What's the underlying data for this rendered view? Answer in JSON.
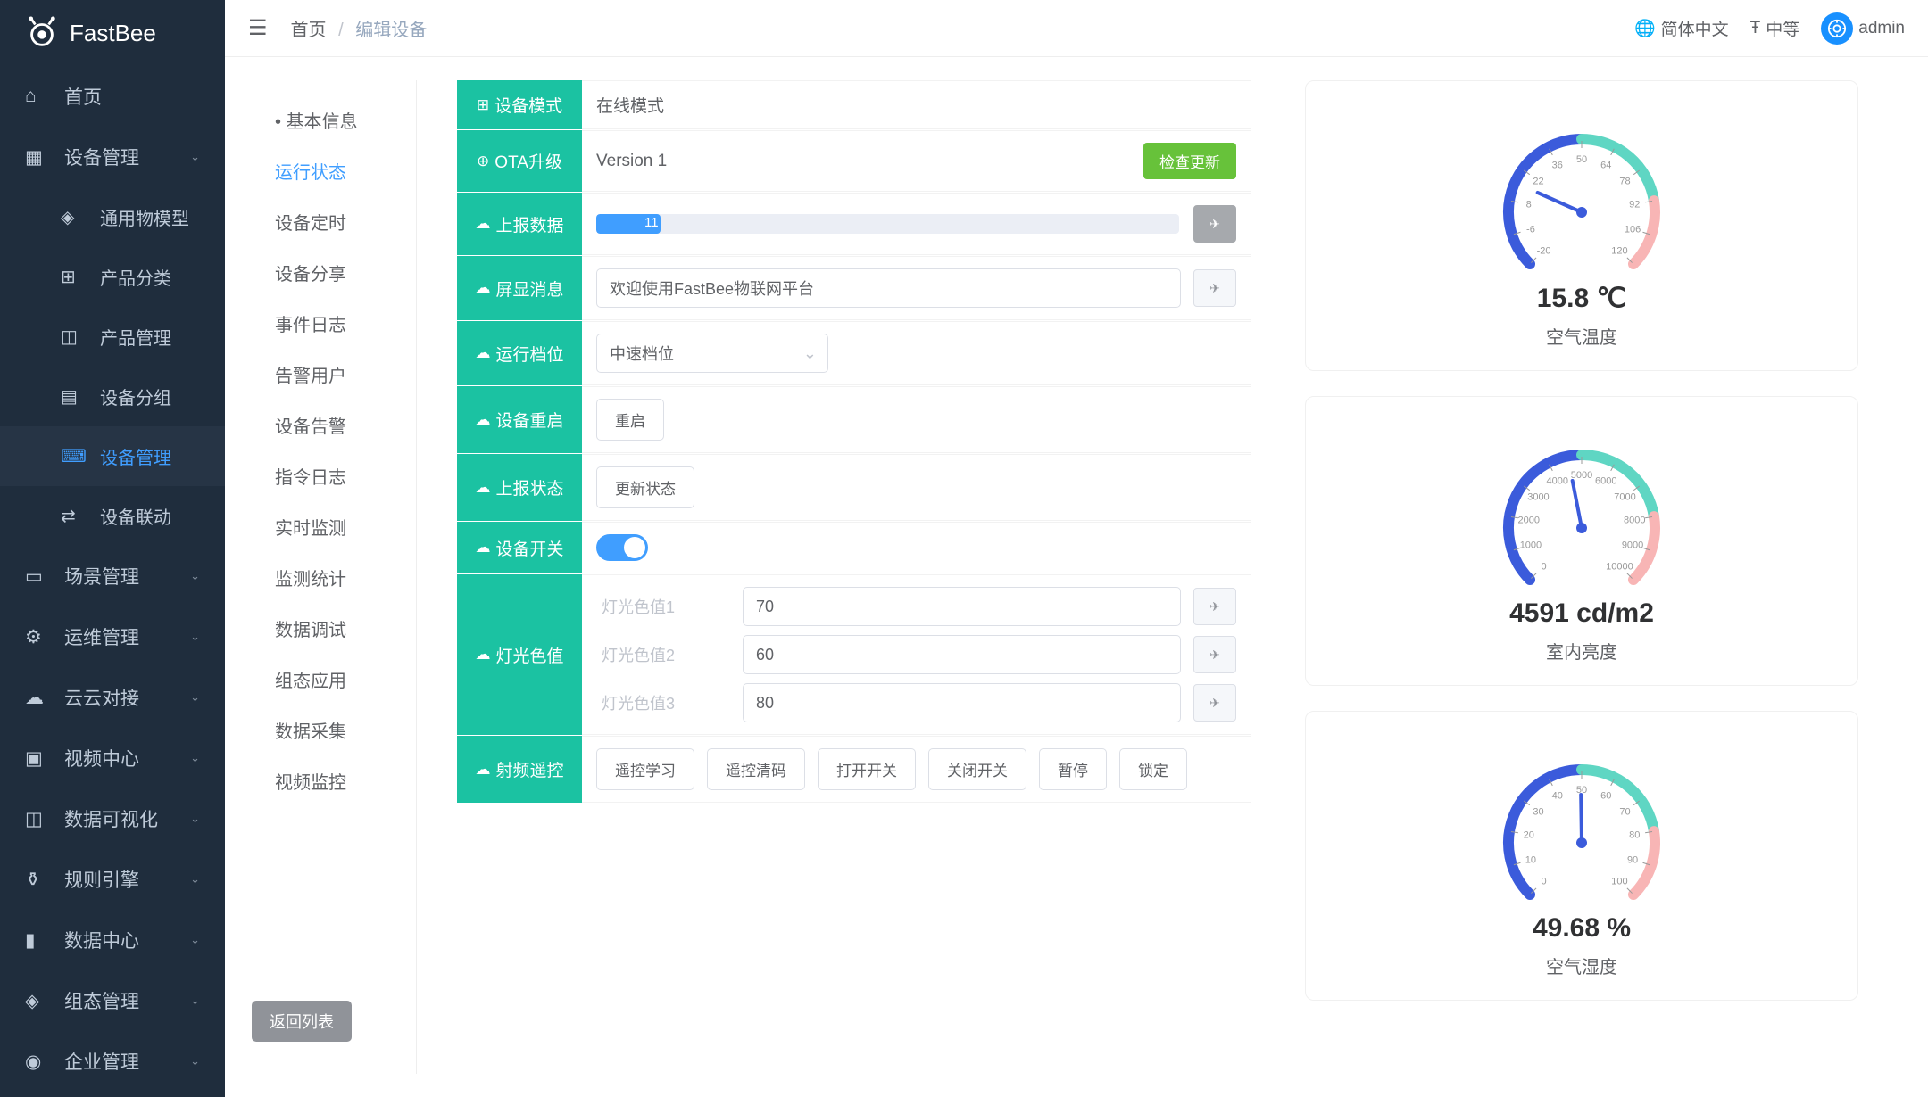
{
  "brand": "FastBee",
  "header": {
    "home": "首页",
    "current": "编辑设备",
    "lang": "简体中文",
    "size": "中等",
    "user": "admin"
  },
  "sidebar": [
    {
      "icon": "home",
      "label": "首页"
    },
    {
      "icon": "grid",
      "label": "设备管理",
      "expanded": true,
      "children": [
        {
          "icon": "model",
          "label": "通用物模型"
        },
        {
          "icon": "category",
          "label": "产品分类"
        },
        {
          "icon": "cube",
          "label": "产品管理"
        },
        {
          "icon": "group",
          "label": "设备分组"
        },
        {
          "icon": "device",
          "label": "设备管理",
          "active": true
        },
        {
          "icon": "link",
          "label": "设备联动"
        }
      ]
    },
    {
      "icon": "scene",
      "label": "场景管理",
      "chev": true
    },
    {
      "icon": "ops",
      "label": "运维管理",
      "chev": true
    },
    {
      "icon": "cloud",
      "label": "云云对接",
      "chev": true
    },
    {
      "icon": "video",
      "label": "视频中心",
      "chev": true
    },
    {
      "icon": "viz",
      "label": "数据可视化",
      "chev": true
    },
    {
      "icon": "rule",
      "label": "规则引擎",
      "chev": true
    },
    {
      "icon": "chart",
      "label": "数据中心",
      "chev": true
    },
    {
      "icon": "org",
      "label": "组态管理",
      "chev": true
    },
    {
      "icon": "ent",
      "label": "企业管理",
      "chev": true
    }
  ],
  "subtabs": [
    {
      "label": "基本信息",
      "dot": true
    },
    {
      "label": "运行状态",
      "active": true
    },
    {
      "label": "设备定时"
    },
    {
      "label": "设备分享"
    },
    {
      "label": "事件日志"
    },
    {
      "label": "告警用户"
    },
    {
      "label": "设备告警"
    },
    {
      "label": "指令日志"
    },
    {
      "label": "实时监测"
    },
    {
      "label": "监测统计"
    },
    {
      "label": "数据调试"
    },
    {
      "label": "组态应用"
    },
    {
      "label": "数据采集"
    },
    {
      "label": "视频监控"
    }
  ],
  "back_btn": "返回列表",
  "form": {
    "device_mode": {
      "label": "设备模式",
      "value": "在线模式"
    },
    "ota": {
      "label": "OTA升级",
      "value": "Version 1",
      "btn": "检查更新"
    },
    "report": {
      "label": "上报数据",
      "progress_text": "11"
    },
    "display_msg": {
      "label": "屏显消息",
      "value": "欢迎使用FastBee物联网平台"
    },
    "run_level": {
      "label": "运行档位",
      "value": "中速档位"
    },
    "reboot": {
      "label": "设备重启",
      "btn": "重启"
    },
    "report_status": {
      "label": "上报状态",
      "btn": "更新状态"
    },
    "switch": {
      "label": "设备开关",
      "on": true
    },
    "color": {
      "label": "灯光色值",
      "rows": [
        {
          "label": "灯光色值1",
          "value": "70"
        },
        {
          "label": "灯光色值2",
          "value": "60"
        },
        {
          "label": "灯光色值3",
          "value": "80"
        }
      ]
    },
    "rf": {
      "label": "射频遥控",
      "btns": [
        "遥控学习",
        "遥控清码",
        "打开开关",
        "关闭开关",
        "暂停",
        "锁定"
      ]
    }
  },
  "gauges": [
    {
      "value": "15.8 ℃",
      "title": "空气温度",
      "min": -20,
      "max": 120,
      "cur": 15.8
    },
    {
      "value": "4591 cd/m2",
      "title": "室内亮度",
      "min": 0,
      "max": 10000,
      "cur": 4591
    },
    {
      "value": "49.68 %",
      "title": "空气湿度",
      "min": 0,
      "max": 100,
      "cur": 49.68
    }
  ],
  "chart_data": [
    {
      "type": "gauge",
      "title": "空气温度",
      "value": 15.8,
      "unit": "℃",
      "min": -20,
      "max": 120
    },
    {
      "type": "gauge",
      "title": "室内亮度",
      "value": 4591,
      "unit": "cd/m2",
      "min": 0,
      "max": 10000
    },
    {
      "type": "gauge",
      "title": "空气湿度",
      "value": 49.68,
      "unit": "%",
      "min": 0,
      "max": 100
    }
  ]
}
